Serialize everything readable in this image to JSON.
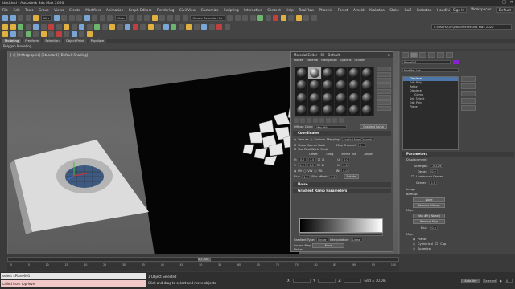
{
  "app": {
    "title": "Untitled - Autodesk 3ds Max 2020",
    "window_controls": [
      "–",
      "□",
      "✕"
    ]
  },
  "menu": {
    "items": [
      "File",
      "Edit",
      "Tools",
      "Group",
      "Views",
      "Create",
      "Modifiers",
      "Animation",
      "Graph Editors",
      "Rendering",
      "Civil View",
      "Customize",
      "Scripting",
      "Interactive",
      "Content",
      "Help",
      "RealFlow",
      "Phoenix",
      "Forest",
      "Arnold",
      "Krakatoa",
      "Stoke",
      "GoZ",
      "Krakatoa",
      "Houdini Engine"
    ],
    "sign_in": "Sign In",
    "workspaces_label": "Workspaces:",
    "workspace_value": "Default"
  },
  "toolbar": {
    "view_dropdown": "View",
    "selection_set_dropdown": "Create Selection Se",
    "path": "C:\\Users\\Gin\\Documents\\3ds Max 2020"
  },
  "ribbon": {
    "tabs": [
      "Modeling",
      "Freeform",
      "Selection",
      "Object Paint",
      "Populate"
    ],
    "active_tab": "Modeling",
    "subtitle": "Polygon Modeling"
  },
  "viewport": {
    "label": "[+] [Orthographic] [Standard] [Default Shading]"
  },
  "material_editor": {
    "title": "Material Editor - 02 - Default",
    "menus": [
      "Modes",
      "Material",
      "Navigation",
      "Options",
      "Utilities"
    ],
    "slot_count": 24,
    "selected_slot": 1,
    "material_name": "Map #9",
    "type_button": "Gradient Ramp",
    "diffuse_label": "Diffuse Color:",
    "coordinates_section": "Coordinates",
    "texture_label": "Texture",
    "environ_label": "Environ",
    "mapping_label": "Mapping:",
    "mapping_value": "Explicit Map Channel",
    "show_map_label": "Show Map on Back",
    "map_channel_label": "Map Channel:",
    "map_channel_value": "1",
    "real_world_label": "Use Real-World Scale",
    "col_offset": "Offset",
    "col_tiling": "Tiling",
    "col_mirror": "Mirror Tile",
    "col_angle": "Angle",
    "u_label": "U:",
    "u_offset": "0.0",
    "u_tiling": "1.0",
    "u_angle": "0.0",
    "v_label": "V:",
    "v_offset": "0.0",
    "v_tiling": "1.0",
    "v_angle": "0.0",
    "w_angle": "0.0",
    "uv_label": "UV",
    "vw_label": "VW",
    "wu_label": "WU",
    "blur_label": "Blur:",
    "blur_value": "1.0",
    "blur_offset_label": "Blur offset:",
    "blur_offset_value": "0.0",
    "rotate_button": "Rotate",
    "noise_section": "Noise",
    "gradient_section": "Gradient Ramp Parameters",
    "gradient_type_label": "Gradient Type:",
    "gradient_type_value": "Linear",
    "interpolation_label": "Interpolation:",
    "interpolation_value": "Linear",
    "source_map_label": "Source Map",
    "source_map_value": "None",
    "noise_label": "Noise:"
  },
  "command_panel": {
    "object_name": "Plane001",
    "modifier_list": "Modifier List",
    "stack": [
      "Displace",
      "Edit Poly",
      "Relax",
      "Displace",
      "Gizmo",
      "Sel. Select",
      "Edit Poly",
      "Plane"
    ],
    "selected_stack_index": 0,
    "parameters_head": "Parameters",
    "displacement_label": "Displacement:",
    "strength_label": "Strength:",
    "strength_value": "-0.22m",
    "decay_label": "Decay:",
    "decay_value": "0.0",
    "luminance_label": "Luminance Center",
    "center_label": "Center:",
    "center_value": "0.5",
    "image_label": "Image",
    "bitmap_label": "Bitmap:",
    "bitmap_value": "None",
    "remove_bitmap": "Remove Bitmap",
    "map_label": "Map:",
    "map_value": "Map #9 ( Noise )",
    "remove_map": "Remove Map",
    "blur_label": "Blur:",
    "blur_value": "0.0",
    "map_section": "Map:",
    "planar": "Planar",
    "cylindrical": "Cylindrical",
    "cap": "Cap",
    "spherical": "Spherical"
  },
  "timeline": {
    "frame_display": "0 / 100",
    "ticks": [
      "0",
      "5",
      "10",
      "15",
      "20",
      "25",
      "30",
      "35",
      "40",
      "45",
      "50",
      "55",
      "60",
      "65",
      "70",
      "75",
      "80",
      "85",
      "90",
      "95",
      "100"
    ]
  },
  "status": {
    "maxscript_line1": "select $Plane001",
    "maxscript_line2": "called from top-level",
    "selection_count": "1 Object Selected",
    "prompt": "Click and drag to select and move objects",
    "x_label": "X:",
    "y_label": "Y:",
    "z_label": "Z:",
    "grid_label": "Grid = 10.0m",
    "add_time_tag": "Add Time Tag",
    "auto_key": "Auto Key",
    "selected_dropdown": "Selected",
    "set_key": "Set Key",
    "key_filters": "Key Filters...",
    "frame_value": "0"
  }
}
